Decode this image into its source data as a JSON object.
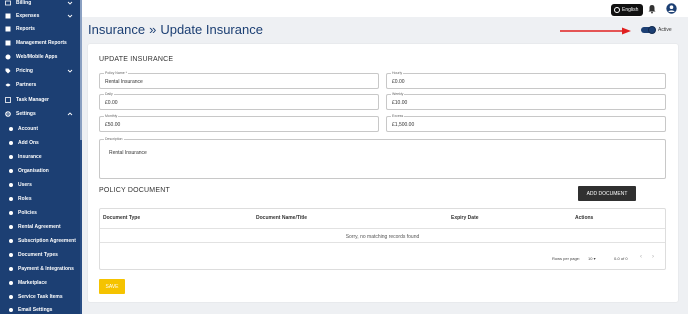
{
  "sidebar": {
    "items": [
      {
        "label": "Billing",
        "icon": "billing-icon"
      },
      {
        "label": "Expenses",
        "icon": "expenses-icon"
      },
      {
        "label": "Reports",
        "icon": "reports-icon"
      },
      {
        "label": "Management Reports",
        "icon": "management-reports-icon"
      },
      {
        "label": "Web/Mobile Apps",
        "icon": "apps-icon"
      },
      {
        "label": "Pricing",
        "icon": "pricing-tag-icon"
      },
      {
        "label": "Partners",
        "icon": "partners-icon"
      },
      {
        "label": "Task Manager",
        "icon": "task-manager-icon"
      },
      {
        "label": "Settings",
        "icon": "gear-icon"
      }
    ],
    "settings_items": [
      "Account",
      "Add Ons",
      "Insurance",
      "Organisation",
      "Users",
      "Roles",
      "Policies",
      "Rental Agreement",
      "Subscription Agreement",
      "Document Types",
      "Payment & Integrations",
      "Marketplace",
      "Service Task Items",
      "Email Settings"
    ]
  },
  "topbar": {
    "language": "English"
  },
  "page": {
    "breadcrumb_parent": "Insurance",
    "breadcrumb_sep": "»",
    "title": "Update Insurance",
    "active_label": "Active",
    "active": true
  },
  "form": {
    "section_title": "UPDATE INSURANCE",
    "fields": {
      "policy_name": {
        "label": "Policy Name *",
        "value": "Rental Insurance"
      },
      "hourly": {
        "label": "Hourly",
        "value": "£0.00"
      },
      "daily": {
        "label": "Daily",
        "value": "£0.00"
      },
      "weekly": {
        "label": "Weekly",
        "value": "£10.00"
      },
      "monthly": {
        "label": "Monthly",
        "value": "£50.00"
      },
      "excess": {
        "label": "Excess",
        "value": "£1,500.00"
      },
      "description": {
        "label": "Description",
        "value": "Rental Insurance"
      }
    }
  },
  "documents": {
    "section_title": "POLICY DOCUMENT",
    "add_button": "ADD DOCUMENT",
    "columns": [
      "Document Type",
      "Document Name/Title",
      "Expiry Date",
      "Actions"
    ],
    "empty_message": "Sorry, no matching records found",
    "rows_per_page_label": "Rows per page:",
    "rows_per_page": "10",
    "page_count": "0-0 of 0"
  },
  "save_button": "SAVE",
  "colors": {
    "sidebar": "#1c3f73",
    "accent": "#1c3f73",
    "save": "#f5c300",
    "arrow": "#e02020"
  }
}
